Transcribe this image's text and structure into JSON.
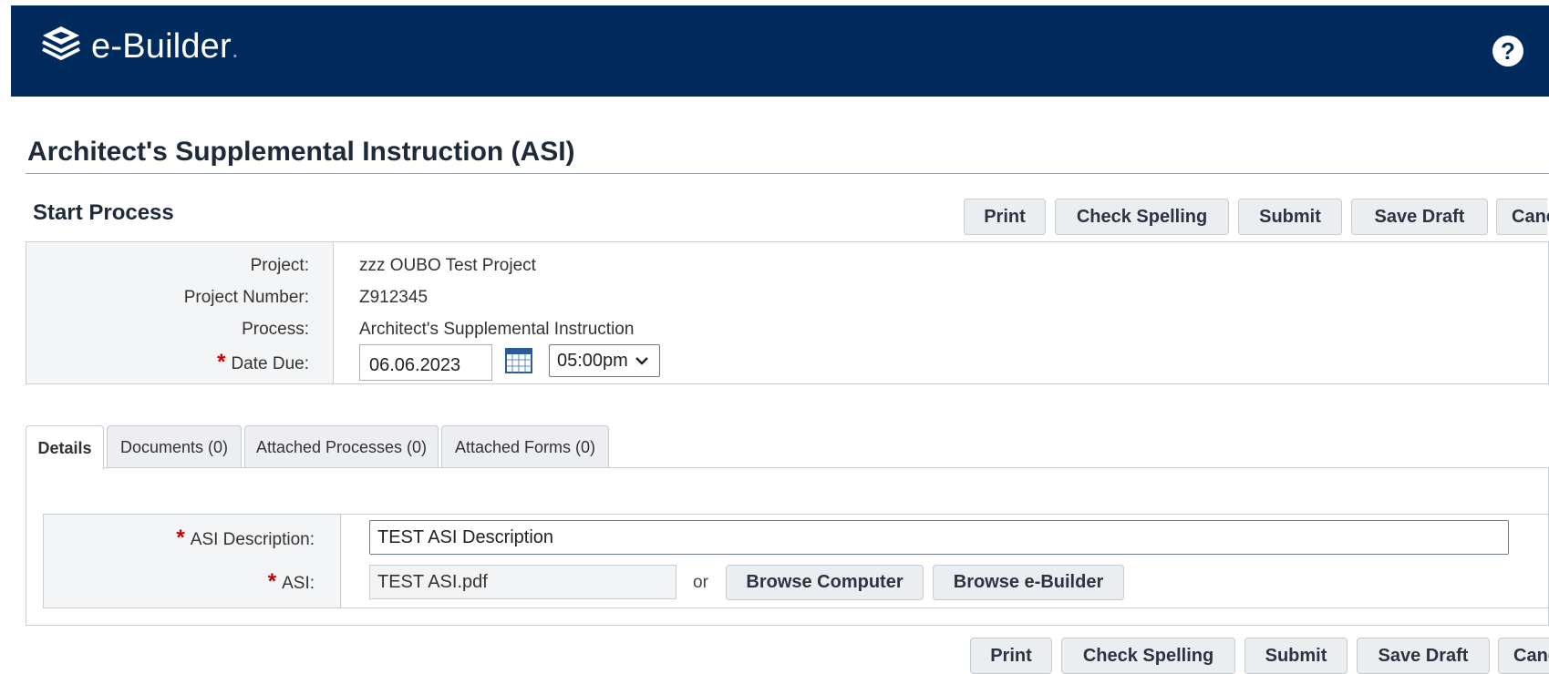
{
  "header": {
    "brand": "e-Builder",
    "brand_dot": ".",
    "logo_icon": "stacked-layers-icon",
    "help_icon": "help-circle-icon",
    "help_glyph": "?",
    "bar_color": "#002b5c"
  },
  "page": {
    "title": "Architect's Supplemental Instruction (ASI)",
    "section_title": "Start Process"
  },
  "toolbar": {
    "print": "Print",
    "check_spelling": "Check Spelling",
    "submit": "Submit",
    "save_draft": "Save Draft",
    "cancel": "Cancel"
  },
  "info": {
    "project_label": "Project:",
    "project_value": "zzz OUBO Test Project",
    "project_number_label": "Project Number:",
    "project_number_value": "Z912345",
    "process_label": "Process:",
    "process_value": "Architect's Supplemental Instruction",
    "required_mark": "*",
    "date_due_label": "Date Due:",
    "date_due_value": "06.06.2023",
    "calendar_icon": "calendar-icon",
    "time_value": "05:00pm"
  },
  "tabs": [
    {
      "label": "Details",
      "active": true
    },
    {
      "label": "Documents (0)",
      "active": false
    },
    {
      "label": "Attached Processes (0)",
      "active": false
    },
    {
      "label": "Attached Forms (0)",
      "active": false
    }
  ],
  "details": {
    "required_mark": "*",
    "asi_description_label": "ASI Description:",
    "asi_description_value": "TEST ASI Description",
    "asi_label": "ASI:",
    "asi_file_value": "TEST ASI.pdf",
    "or_text": "or",
    "browse_computer": "Browse Computer",
    "browse_ebuilder": "Browse e-Builder"
  },
  "colors": {
    "header_bg": "#002b5c",
    "required": "#cc0000",
    "button_bg": "#ebeef1"
  }
}
